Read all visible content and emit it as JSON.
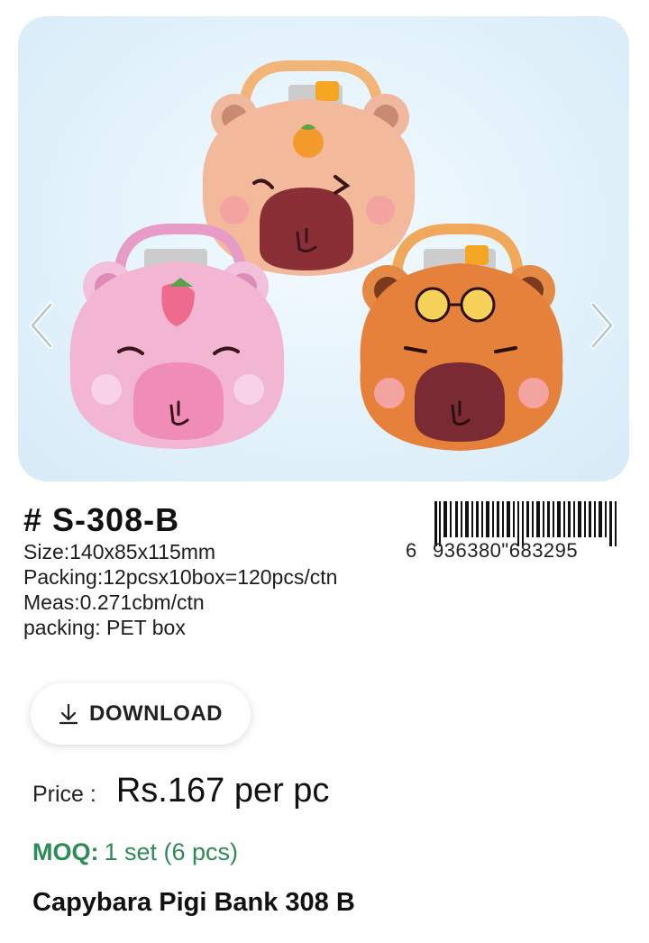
{
  "gallery": {
    "prev_icon": "chevron-left-icon",
    "next_icon": "chevron-right-icon",
    "colors": {
      "pink": "#f2b6d3",
      "peach": "#f2b99a",
      "orange": "#e5813b",
      "background": "#e3f2fb"
    }
  },
  "product": {
    "sku": "# S-308-B",
    "specs": {
      "size": "Size:140x85x115mm",
      "packing": "Packing:12pcsx10box=120pcs/ctn",
      "meas": "Meas:0.271cbm/ctn",
      "packing_type": "packing: PET box"
    },
    "barcode": {
      "lead_digit": "6",
      "digits": "936380\"683295"
    },
    "name": "Capybara Pigi Bank 308 B"
  },
  "download": {
    "label": "DOWNLOAD",
    "icon": "download-icon"
  },
  "price": {
    "label": "Price :",
    "value": "Rs.167 per pc"
  },
  "moq": {
    "label": "MOQ:",
    "value": "1 set (6 pcs)",
    "color": "#2e8b57"
  }
}
